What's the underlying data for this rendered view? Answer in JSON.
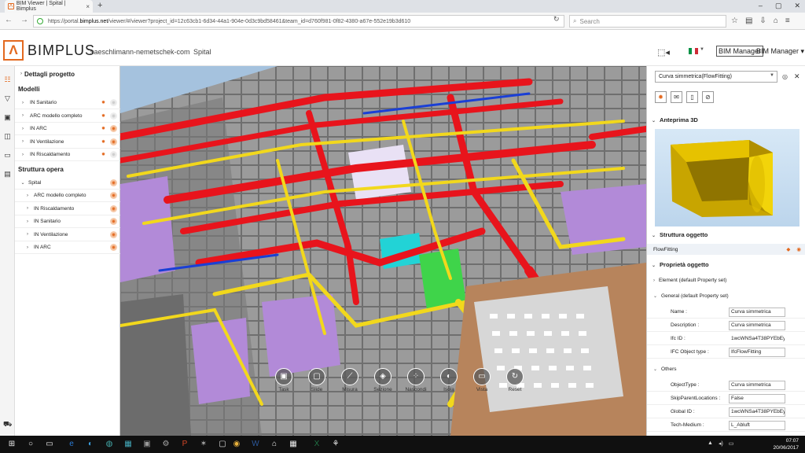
{
  "browser": {
    "tab_title": "BIM Viewer | Spital | Bimplus",
    "tab_close": "×",
    "new_tab": "+",
    "url_prefix": "https://portal.",
    "url_host": "bimplus.net",
    "url_rest": "/viewer/#/viewer?project_id=12c63cb1-6d34-44a1-904e-0d3c9bd58461&team_id=d760f981-0f82-4380-a67e-552e19b3d610",
    "search_placeholder": "Search",
    "window_controls": [
      "–",
      "▢",
      "✕"
    ]
  },
  "app": {
    "logo_symbol": "Λ",
    "brand": "BIMPLUS",
    "tenant": "saeschlimann-nemetschek-com",
    "project": "Spital",
    "role_box": "BIM Manager",
    "role_menu": "BIM Manager ▾",
    "flag_colors": [
      "#009246",
      "#ffffff",
      "#ce2b37"
    ]
  },
  "tree": {
    "project_details": "Dettagli progetto",
    "models_header": "Modelli",
    "models": [
      {
        "label": "IN Sanitario",
        "visible": false
      },
      {
        "label": "ARC modello completo",
        "visible": false
      },
      {
        "label": "IN ARC",
        "visible": true
      },
      {
        "label": "IN Ventilazione",
        "visible": true
      },
      {
        "label": "IN Riscaldamento",
        "visible": false
      }
    ],
    "structure_header": "Struttura opera",
    "root": "Spital",
    "structure": [
      "ARC modello completo",
      "IN Riscaldamento",
      "IN Sanitario",
      "IN Ventilazione",
      "IN ARC"
    ]
  },
  "toolbar": {
    "tools": [
      {
        "label": "Task",
        "icon": "clipboard-icon"
      },
      {
        "label": "Slide",
        "icon": "slide-icon"
      },
      {
        "label": "Misura",
        "icon": "ruler-icon"
      },
      {
        "label": "Sezione",
        "icon": "section-icon"
      },
      {
        "label": "Nascondi",
        "icon": "hide-icon"
      },
      {
        "label": "Isola",
        "icon": "isolate-icon"
      },
      {
        "label": "Vista",
        "icon": "camera-icon"
      },
      {
        "label": "Reset",
        "icon": "reset-icon"
      }
    ]
  },
  "panel": {
    "selected_object": "Curva simmetrica(FlowFitting)",
    "preview_header": "Anteprima 3D",
    "structure_header": "Struttura oggetto",
    "structure_item": "FlowFitting",
    "properties_header": "Proprietà oggetto",
    "element_set": "Element (default Property set)",
    "general_set": "General (default Property set)",
    "general_props": [
      {
        "key": "Name :",
        "value": "Curva simmetrica",
        "editable": true
      },
      {
        "key": "Description :",
        "value": "Curva simmetrica",
        "editable": true
      },
      {
        "key": "Ifc ID :",
        "value": "1wcWNSa4T38PYEbEyu",
        "editable": false
      },
      {
        "key": "IFC Object type :",
        "value": "IfcFlowFitting",
        "editable": true
      }
    ],
    "others_header": "Others",
    "other_props": [
      {
        "key": "ObjectType :",
        "value": "Curva simmetrica",
        "editable": true
      },
      {
        "key": "SkipParentLocations :",
        "value": "False",
        "editable": true
      },
      {
        "key": "Global ID :",
        "value": "1wcWNSa4T38PYEbEyu",
        "editable": true
      },
      {
        "key": "Tech-Medium :",
        "value": "L_Abluft",
        "editable": true
      }
    ]
  },
  "taskbar": {
    "time": "07:07",
    "date": "20/06/2017"
  },
  "colors": {
    "accent": "#e3691f",
    "pipe_red": "#e8141c",
    "pipe_yellow": "#f2d81c",
    "wall_gray": "#8a8a8a",
    "room_purple": "#b28ad8"
  }
}
